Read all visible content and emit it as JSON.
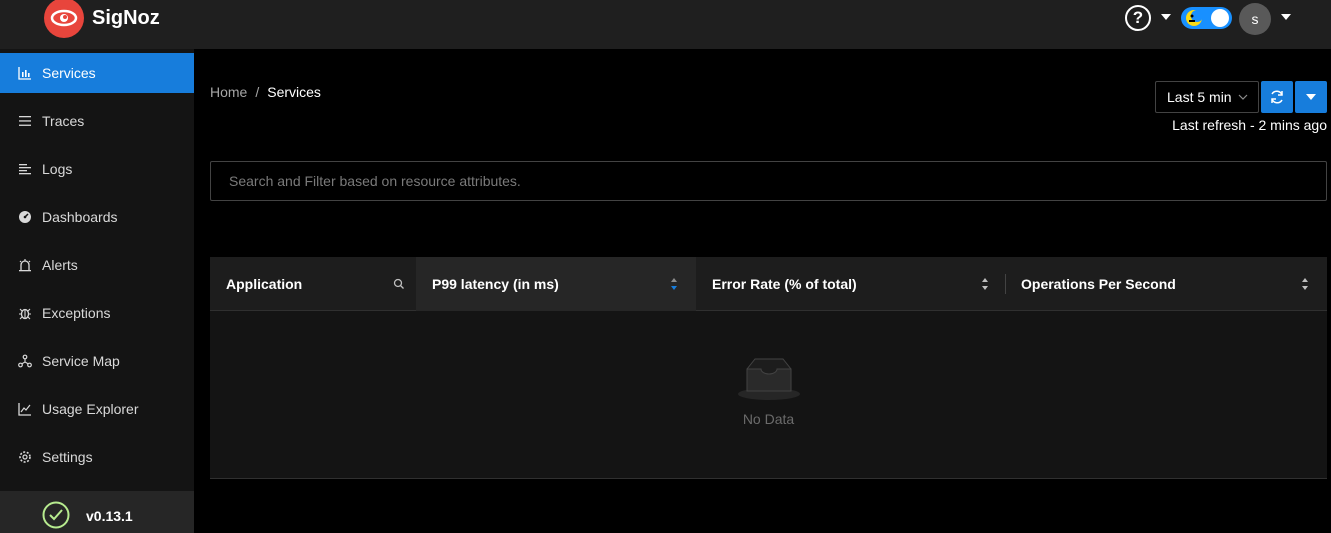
{
  "header": {
    "brand": "SigNoz",
    "help_label": "?",
    "avatar_initial": "s",
    "colors": {
      "logo_red": "#e8453c",
      "toggle_blue": "#1890ff"
    }
  },
  "sidebar": {
    "items": [
      {
        "label": "Services",
        "icon": "bar-chart-icon",
        "active": true
      },
      {
        "label": "Traces",
        "icon": "menu-icon",
        "active": false
      },
      {
        "label": "Logs",
        "icon": "align-left-icon",
        "active": false
      },
      {
        "label": "Dashboards",
        "icon": "dashboard-icon",
        "active": false
      },
      {
        "label": "Alerts",
        "icon": "alert-icon",
        "active": false
      },
      {
        "label": "Exceptions",
        "icon": "bug-icon",
        "active": false
      },
      {
        "label": "Service Map",
        "icon": "deployment-unit-icon",
        "active": false
      },
      {
        "label": "Usage Explorer",
        "icon": "line-chart-icon",
        "active": false
      },
      {
        "label": "Settings",
        "icon": "setting-icon",
        "active": false
      }
    ],
    "version": "v0.13.1"
  },
  "breadcrumb": {
    "home": "Home",
    "separator": "/",
    "current": "Services"
  },
  "time_range": {
    "selected": "Last 5 min",
    "last_refresh": "Last refresh - 2 mins ago"
  },
  "search": {
    "placeholder": "Search and Filter based on resource attributes."
  },
  "table": {
    "columns": [
      {
        "label": "Application"
      },
      {
        "label": "P99 latency (in ms)"
      },
      {
        "label": "Error Rate (% of total)"
      },
      {
        "label": "Operations Per Second"
      }
    ],
    "empty_text": "No Data"
  }
}
